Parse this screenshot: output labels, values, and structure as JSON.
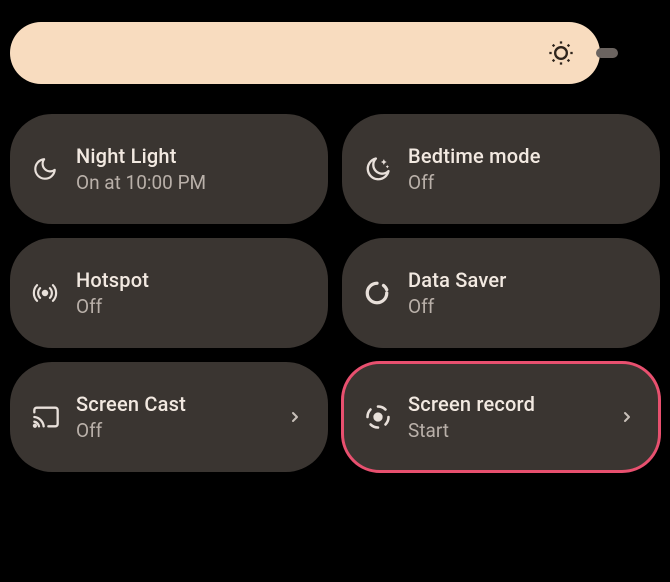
{
  "brightness": {
    "icon": "brightness-icon"
  },
  "tiles": [
    {
      "title": "Night Light",
      "sub": "On at 10:00 PM"
    },
    {
      "title": "Bedtime mode",
      "sub": "Off"
    },
    {
      "title": "Hotspot",
      "sub": "Off"
    },
    {
      "title": "Data Saver",
      "sub": "Off"
    },
    {
      "title": "Screen Cast",
      "sub": "Off"
    },
    {
      "title": "Screen record",
      "sub": "Start"
    }
  ]
}
